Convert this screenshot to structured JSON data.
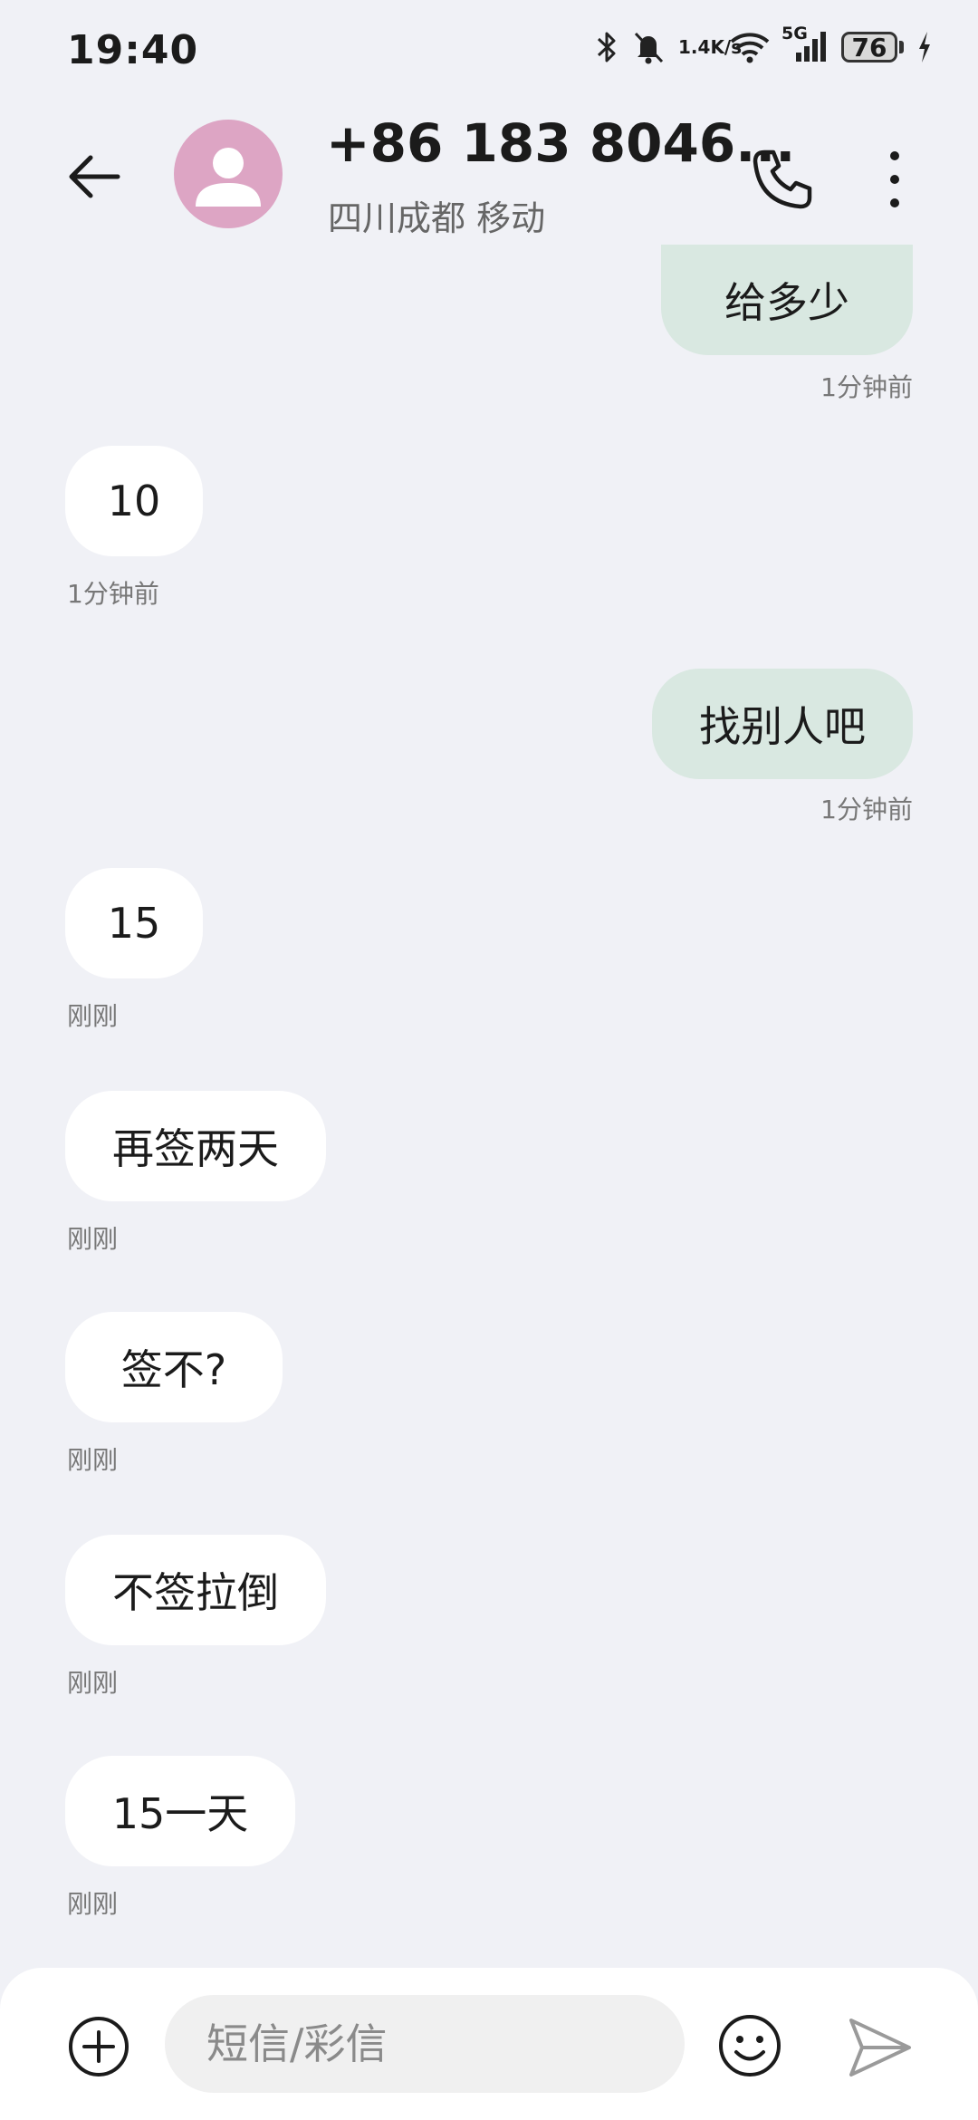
{
  "status": {
    "time": "19:40",
    "net_speed_value": "1.4",
    "net_speed_unit": "K/s",
    "network": "5G",
    "battery": "76"
  },
  "header": {
    "contact_name": "+86 183 8046...",
    "contact_location": "四川成都 移动"
  },
  "messages": [
    {
      "text": "给多少",
      "time": "1分钟前",
      "direction": "outgoing"
    },
    {
      "text": "10",
      "time": "1分钟前",
      "direction": "incoming"
    },
    {
      "text": "找别人吧",
      "time": "1分钟前",
      "direction": "outgoing"
    },
    {
      "text": "15",
      "time": "刚刚",
      "direction": "incoming"
    },
    {
      "text": "再签两天",
      "time": "刚刚",
      "direction": "incoming"
    },
    {
      "text": "签不?",
      "time": "刚刚",
      "direction": "incoming"
    },
    {
      "text": "不签拉倒",
      "time": "刚刚",
      "direction": "incoming"
    },
    {
      "text": "15一天",
      "time": "刚刚",
      "direction": "incoming"
    }
  ],
  "composer": {
    "placeholder": "短信/彩信"
  },
  "icons": {
    "back": "arrow-left-icon",
    "call": "phone-icon",
    "more": "more-vertical-icon",
    "add": "plus-circle-icon",
    "emoji": "emoji-icon",
    "send": "send-icon"
  },
  "colors": {
    "background": "#f0f1f6",
    "outgoing_bubble": "#d9e8e1",
    "incoming_bubble": "#ffffff",
    "avatar": "#dda5c4"
  }
}
